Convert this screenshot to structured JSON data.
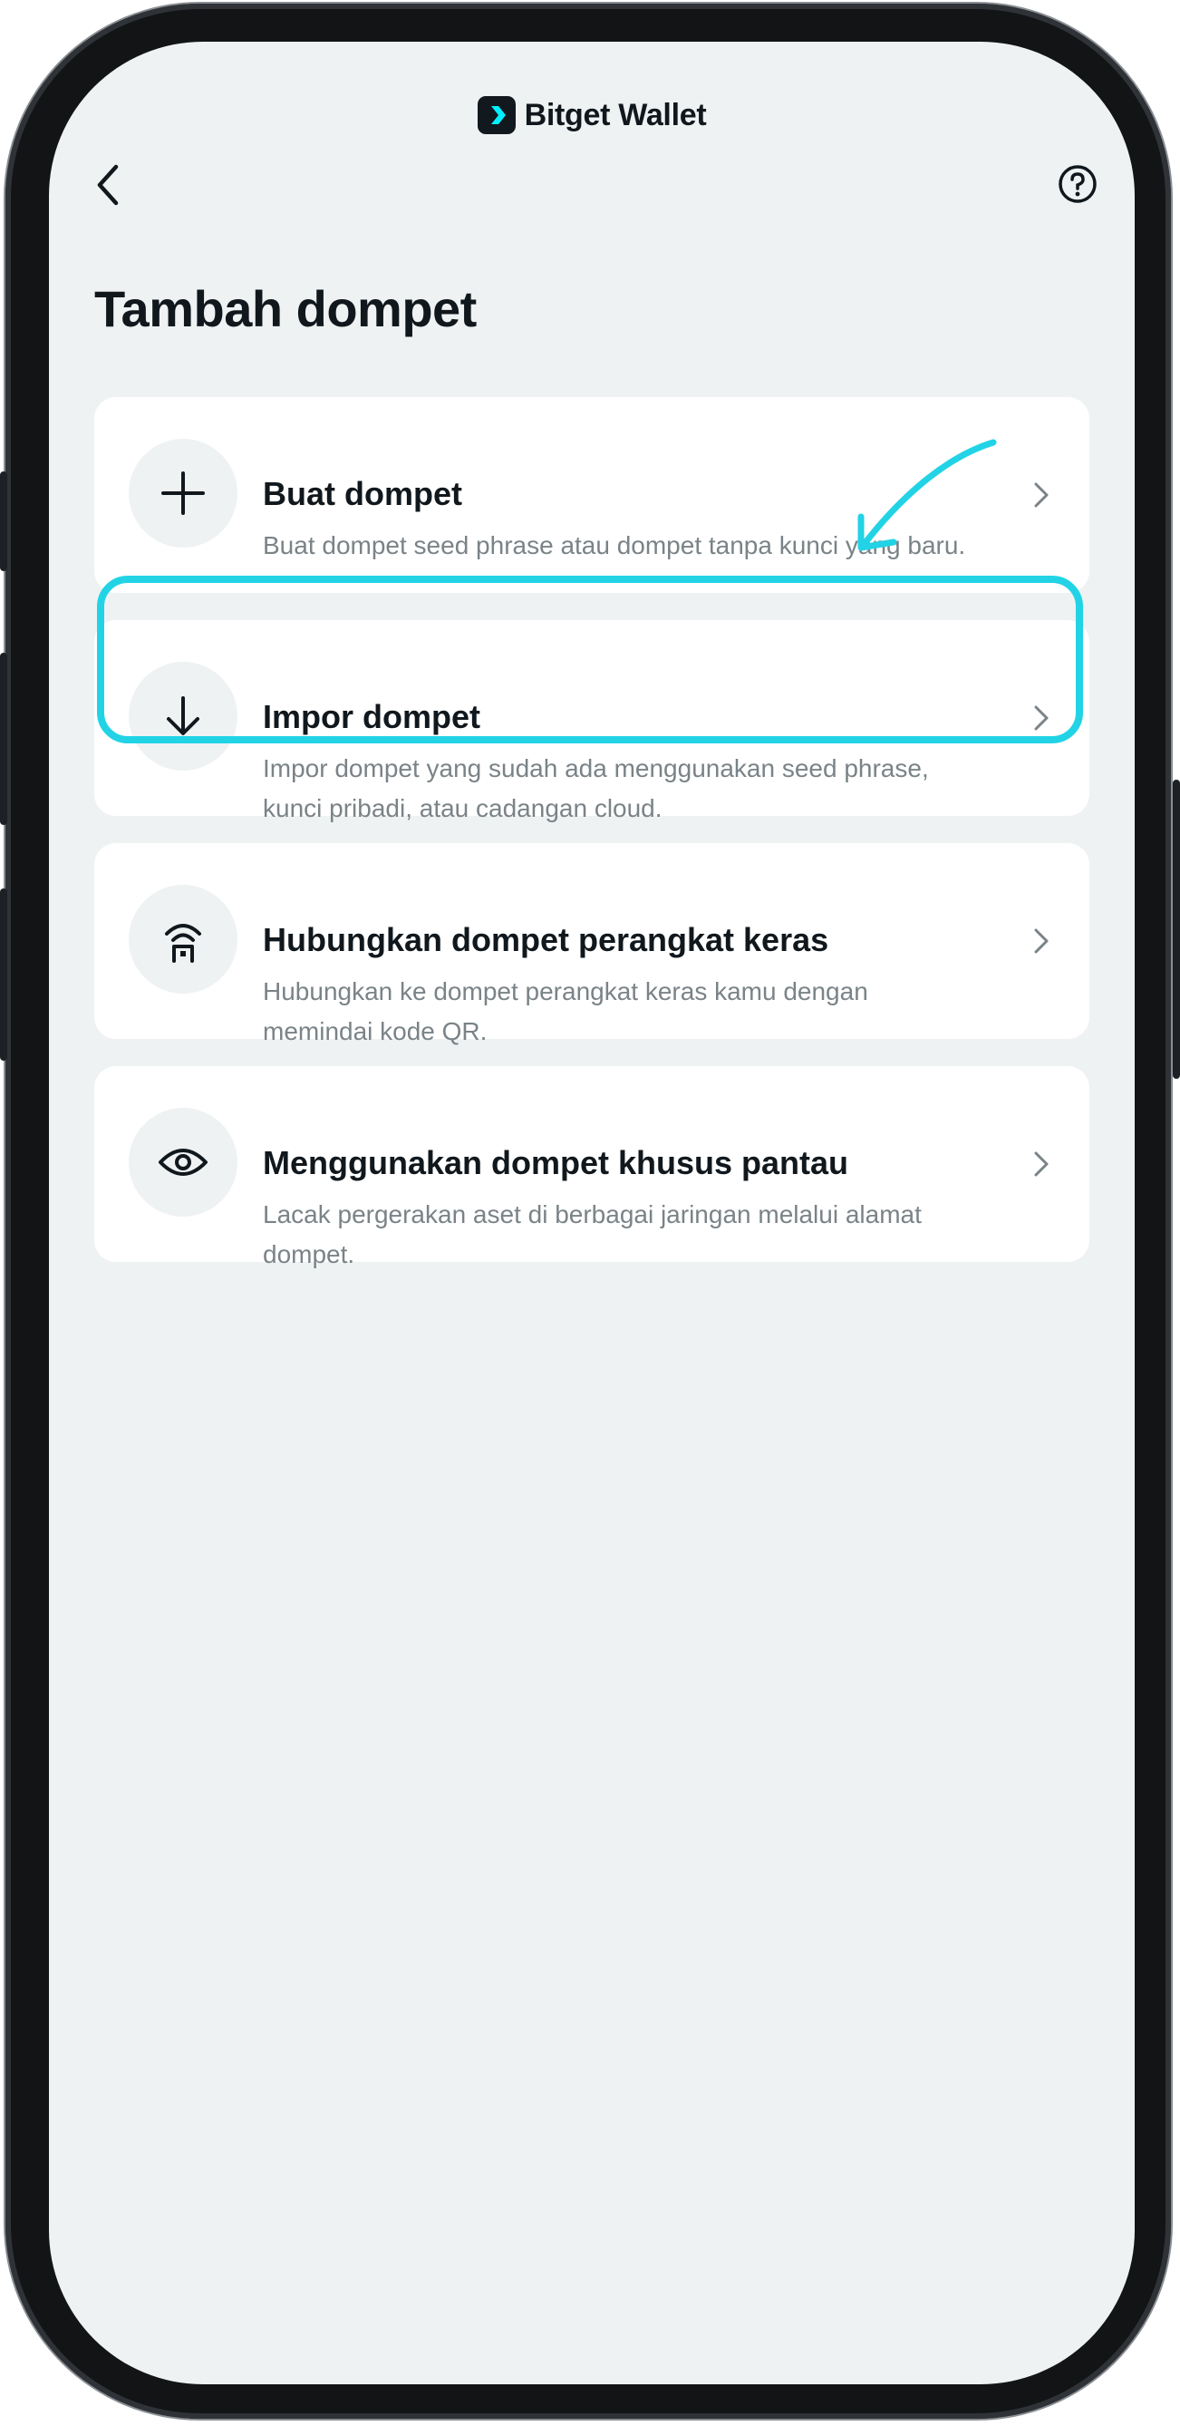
{
  "header": {
    "brand_name": "Bitget Wallet",
    "back_icon": "chevron-left-icon",
    "help_icon": "question-circle-icon"
  },
  "page": {
    "title": "Tambah dompet"
  },
  "options": [
    {
      "title": "Buat dompet",
      "description": "Buat dompet seed phrase atau dompet tanpa kunci yang baru.",
      "icon": "plus-icon"
    },
    {
      "title": "Impor dompet",
      "description": "Impor dompet yang sudah ada menggunakan seed phrase, kunci pribadi, atau cadangan cloud.",
      "icon": "arrow-down-icon"
    },
    {
      "title": "Hubungkan dompet perangkat keras",
      "description": "Hubungkan ke dompet perangkat keras kamu dengan memindai kode QR.",
      "icon": "hardware-wallet-icon"
    },
    {
      "title": "Menggunakan dompet khusus pantau",
      "description": "Lacak pergerakan aset di berbagai jaringan melalui alamat dompet.",
      "icon": "eye-icon"
    }
  ],
  "annotation": {
    "color": "#22d3e6",
    "highlighted_option": "Impor dompet"
  },
  "colors": {
    "background": "#eff2f3",
    "card": "#ffffff",
    "text_primary": "#11181d",
    "text_secondary": "#7a8387",
    "brand_green": "#00f0ff"
  }
}
